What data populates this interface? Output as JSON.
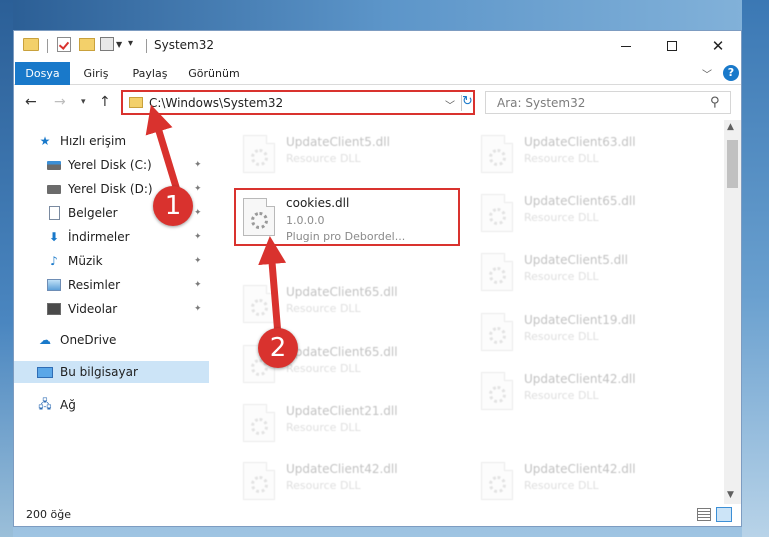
{
  "window": {
    "title": "System32",
    "qa_pin": "▾"
  },
  "ribbon": {
    "tabs": [
      {
        "label": "Dosya",
        "active": true
      },
      {
        "label": "Giriş"
      },
      {
        "label": "Paylaş"
      },
      {
        "label": "Görünüm"
      }
    ],
    "help": "?"
  },
  "address": {
    "path": "C:\\Windows\\System32",
    "search_placeholder": "Ara: System32"
  },
  "navpane": {
    "quick_access": "Hızlı erişim",
    "items": [
      {
        "label": "Yerel Disk (C:)",
        "icon": "drive-c-icon"
      },
      {
        "label": "Yerel Disk (D:)",
        "icon": "drive-icon"
      },
      {
        "label": "Belgeler",
        "icon": "documents-icon"
      },
      {
        "label": "İndirmeler",
        "icon": "downloads-icon"
      },
      {
        "label": "Müzik",
        "icon": "music-icon"
      },
      {
        "label": "Resimler",
        "icon": "pictures-icon"
      },
      {
        "label": "Videolar",
        "icon": "videos-icon"
      }
    ],
    "onedrive": "OneDrive",
    "this_pc": "Bu bilgisayar",
    "network": "Ağ"
  },
  "files": {
    "left": [
      {
        "name": "UpdateClient5.dll",
        "type": "Resource DLL"
      },
      {
        "name": "UpdateClient65.dll",
        "type": "Resource DLL"
      },
      {
        "name": "UpdateClient65.dll",
        "type": "Resource DLL"
      },
      {
        "name": "UpdateClient21.dll",
        "type": "Resource DLL"
      },
      {
        "name": "UpdateClient42.dll",
        "type": "Resource DLL"
      }
    ],
    "right": [
      {
        "name": "UpdateClient63.dll",
        "type": "Resource DLL"
      },
      {
        "name": "UpdateClient65.dll",
        "type": "Resource DLL"
      },
      {
        "name": "UpdateClient5.dll",
        "type": "Resource DLL"
      },
      {
        "name": "UpdateClient19.dll",
        "type": "Resource DLL"
      },
      {
        "name": "UpdateClient42.dll",
        "type": "Resource DLL"
      },
      {
        "name": "UpdateClient42.dll",
        "type": "Resource DLL"
      }
    ],
    "highlighted": {
      "name": "cookies.dll",
      "version": "1.0.0.0",
      "description": "Plugin pro Debordel..."
    }
  },
  "status": {
    "count": "200 öğe"
  },
  "annotations": {
    "step1": "1",
    "step2": "2",
    "accent": "#d9322e"
  }
}
